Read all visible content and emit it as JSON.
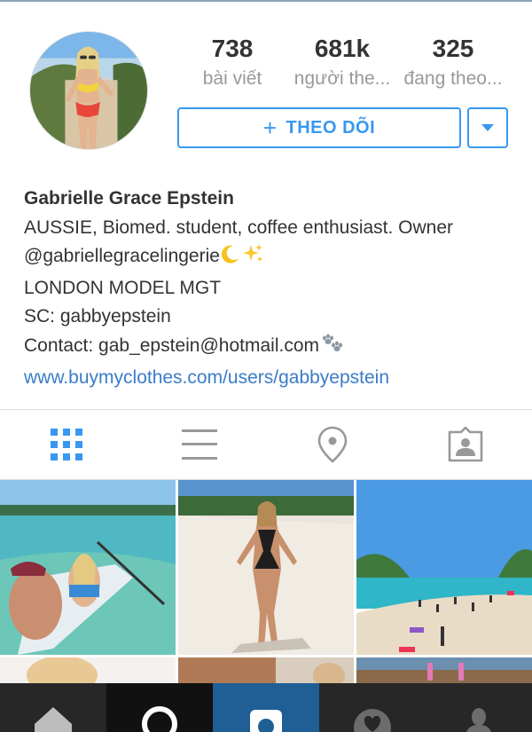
{
  "profile": {
    "stats": {
      "posts": {
        "count": "738",
        "label": "bài viết"
      },
      "followers": {
        "count": "681k",
        "label": "người the..."
      },
      "following": {
        "count": "325",
        "label": "đang theo..."
      }
    },
    "follow_button": {
      "icon": "plus-icon",
      "label": "THEO DÕI"
    },
    "dropdown_icon": "chevron-down-icon",
    "avatar_icon": "avatar"
  },
  "bio": {
    "name": "Gabrielle Grace Epstein",
    "line1": "AUSSIE, Biomed. student, coffee enthusiast. Owner",
    "line2": "@gabriellegracelingerie",
    "line2_emoji": [
      "crescent-moon",
      "sparkles"
    ],
    "line3": "LONDON MODEL MGT",
    "line4": "SC: gabbyepstein",
    "line5": "Contact: gab_epstein@hotmail.com",
    "line5_emoji": "paw-prints",
    "website": "www.buymyclothes.com/users/gabbyepstein"
  },
  "tabs": [
    {
      "icon": "grid-icon",
      "active": true
    },
    {
      "icon": "list-icon",
      "active": false
    },
    {
      "icon": "location-pin-icon",
      "active": false
    },
    {
      "icon": "tagged-person-icon",
      "active": false
    }
  ],
  "bottom_nav": [
    {
      "icon": "home-icon"
    },
    {
      "icon": "search-icon"
    },
    {
      "icon": "camera-icon",
      "active": true
    },
    {
      "icon": "heart-icon"
    },
    {
      "icon": "profile-icon"
    }
  ],
  "colors": {
    "accent": "#3897f0",
    "link": "#3a7cc8",
    "stat_label": "#999999",
    "nav_bg": "#272727",
    "nav_active": "#1f5f95"
  }
}
